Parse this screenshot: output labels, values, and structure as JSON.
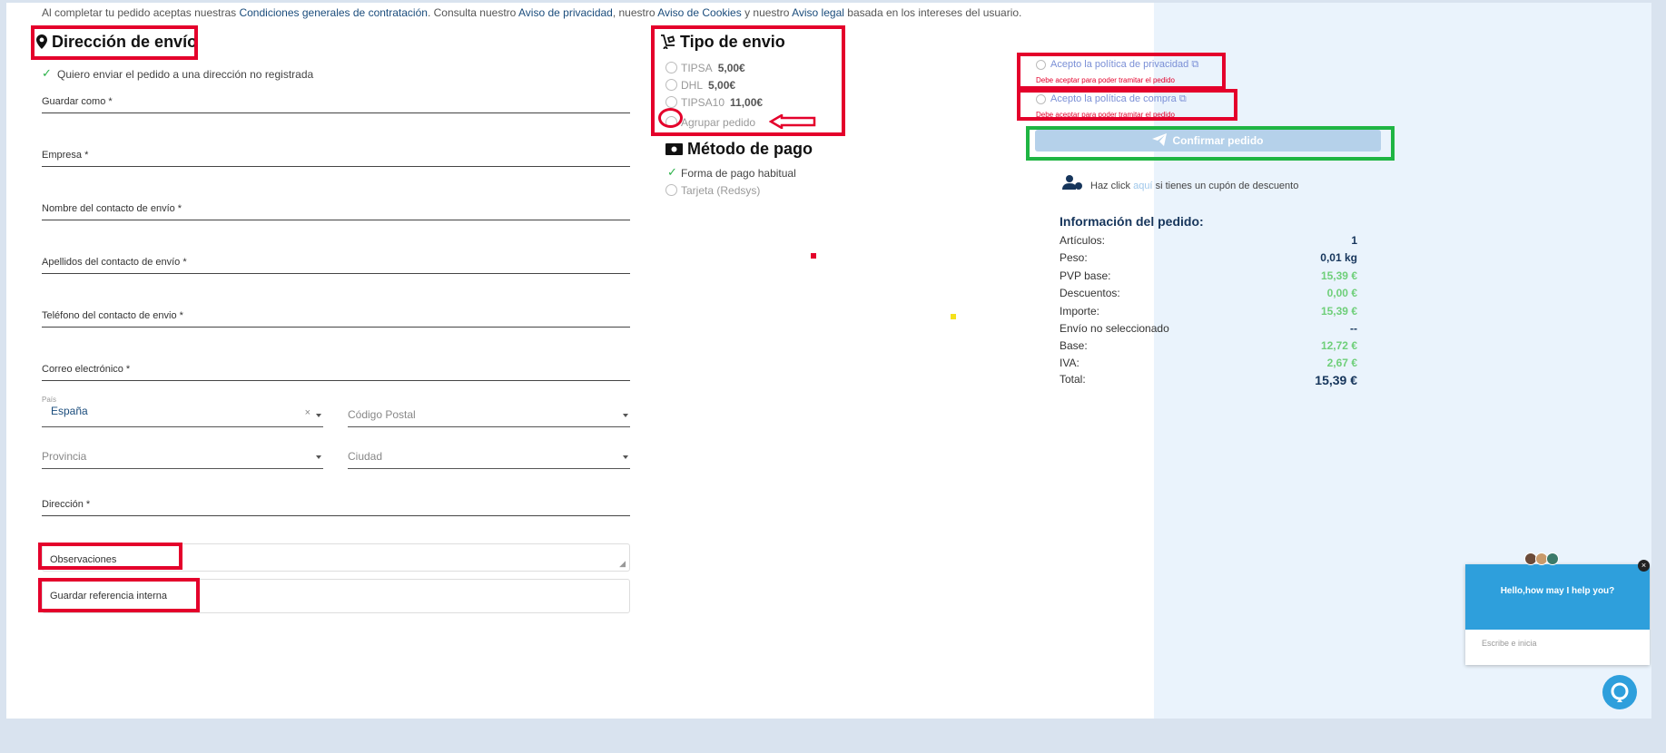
{
  "top_note": {
    "prefix": "Al completar tu pedido aceptas nuestras",
    "link1": "Condiciones generales de contratación",
    "mid1": ". Consulta nuestro",
    "link2": "Aviso de privacidad",
    "mid2": ", nuestro",
    "link3": "Aviso de Cookies",
    "mid3": "y nuestro",
    "link4": "Aviso legal",
    "suffix": "basada en los intereses del usuario."
  },
  "shipping": {
    "title": "Dirección de envío",
    "unregistered": "Quiero enviar el pedido a una dirección no registrada",
    "fields": {
      "save_as": "Guardar como *",
      "company": "Empresa *",
      "contact_name": "Nombre del contacto de envío *",
      "contact_surname": "Apellidos del contacto de envío *",
      "contact_phone": "Teléfono del contacto de envio *",
      "email": "Correo electrónico *",
      "address": "Dirección *"
    },
    "country_label": "País",
    "country_value": "España",
    "postal_code": "Código Postal",
    "province": "Provincia",
    "city": "Ciudad",
    "observations": "Observaciones",
    "internal_ref": "Guardar referencia interna"
  },
  "shipping_type": {
    "title": "Tipo de envio",
    "options": [
      {
        "name": "TIPSA",
        "price": "5,00€"
      },
      {
        "name": "DHL",
        "price": "5,00€"
      },
      {
        "name": "TIPSA10",
        "price": "11,00€"
      }
    ],
    "group": "Agrupar pedido"
  },
  "payment": {
    "title": "Método de pago",
    "habitual": "Forma de pago habitual",
    "card": "Tarjeta (Redsys)"
  },
  "policies": {
    "privacy": "Acepto la política de privacidad",
    "purchase": "Acepto la política de compra",
    "error": "Debe aceptar para poder tramitar el pedido"
  },
  "confirm_label": "Confirmar pedido",
  "coupon": {
    "prefix": "Haz click",
    "link": "aquí",
    "suffix": "si tienes un cupón de descuento"
  },
  "order_info": {
    "title": "Información del pedido:",
    "rows": [
      {
        "label": "Artículos:",
        "value": "1"
      },
      {
        "label": "Peso:",
        "value": "0,01 kg"
      },
      {
        "label": "PVP base:",
        "value": "15,39 €"
      },
      {
        "label": "Descuentos:",
        "value": "0,00 €"
      },
      {
        "label": "Importe:",
        "value": "15,39 €"
      },
      {
        "label": "Envío no seleccionado",
        "value": "--"
      },
      {
        "label": "Base:",
        "value": "12,72 €"
      },
      {
        "label": "IVA:",
        "value": "2,67 €"
      },
      {
        "label": "Total:",
        "value": "15,39 €"
      }
    ]
  },
  "chat": {
    "greeting": "Hello,how may I help you?",
    "placeholder": "Escribe e inicia"
  },
  "colors": {
    "accent": "#16355b",
    "green": "#6fcf7a",
    "annotation_red": "#e4002b",
    "annotation_green": "#1fb543",
    "chat_blue": "#2e9fdc"
  }
}
